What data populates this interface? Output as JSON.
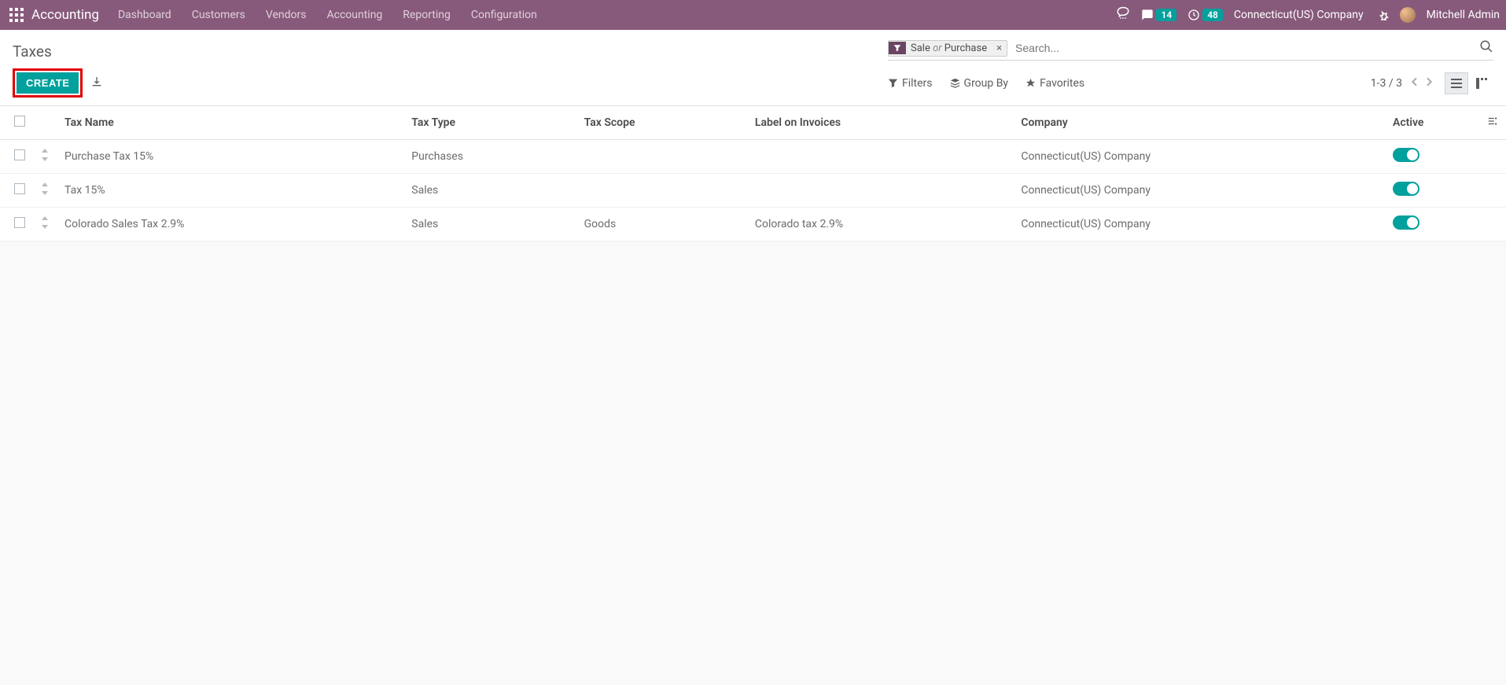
{
  "topbar": {
    "module": "Accounting",
    "menu": [
      "Dashboard",
      "Customers",
      "Vendors",
      "Accounting",
      "Reporting",
      "Configuration"
    ],
    "messages_count": "14",
    "activities_count": "48",
    "company": "Connecticut(US) Company",
    "user": "Mitchell Admin"
  },
  "page": {
    "title": "Taxes",
    "create_label": "CREATE",
    "search_placeholder": "Search...",
    "facet_left": "Sale",
    "facet_or": "or",
    "facet_right": "Purchase",
    "filters": "Filters",
    "group_by": "Group By",
    "favorites": "Favorites",
    "pager": "1-3 / 3"
  },
  "columns": {
    "name": "Tax Name",
    "type": "Tax Type",
    "scope": "Tax Scope",
    "label": "Label on Invoices",
    "company": "Company",
    "active": "Active"
  },
  "rows": [
    {
      "name": "Purchase Tax 15%",
      "type": "Purchases",
      "scope": "",
      "label": "",
      "company": "Connecticut(US) Company",
      "active": true
    },
    {
      "name": "Tax 15%",
      "type": "Sales",
      "scope": "",
      "label": "",
      "company": "Connecticut(US) Company",
      "active": true
    },
    {
      "name": "Colorado Sales Tax 2.9%",
      "type": "Sales",
      "scope": "Goods",
      "label": "Colorado tax 2.9%",
      "company": "Connecticut(US) Company",
      "active": true
    }
  ]
}
